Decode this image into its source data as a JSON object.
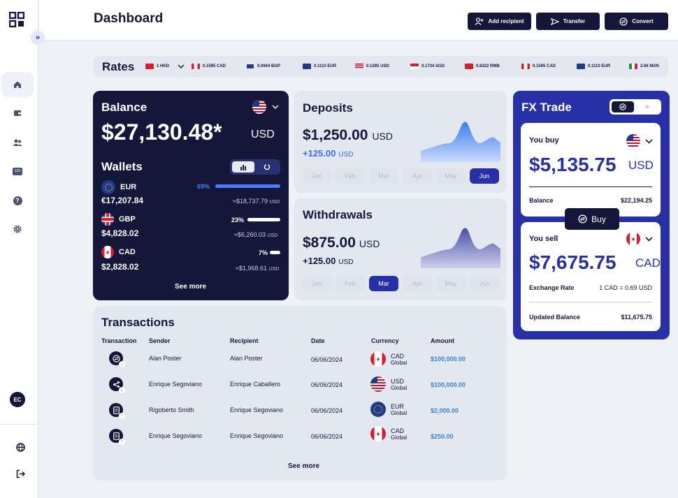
{
  "header": {
    "title": "Dashboard",
    "buttons": [
      {
        "label": "Add recipient",
        "icon": "add-user-icon"
      },
      {
        "label": "Transfer",
        "icon": "send-icon"
      },
      {
        "label": "Convert",
        "icon": "convert-icon"
      }
    ]
  },
  "sidebar": {
    "logo": "grid-logo",
    "items": [
      {
        "icon": "home-icon",
        "active": true
      },
      {
        "icon": "wallet-icon"
      },
      {
        "icon": "users-icon"
      },
      {
        "icon": "number-icon"
      },
      {
        "icon": "help-icon"
      },
      {
        "icon": "settings-icon"
      }
    ],
    "number_icon_text": "123",
    "avatar_initials": "EC",
    "bottom": [
      {
        "icon": "globe-icon"
      },
      {
        "icon": "logout-icon"
      }
    ]
  },
  "rates": {
    "title": "Rates",
    "items": [
      {
        "label": "1 HKD",
        "flag_color": "#d81e2c"
      },
      {
        "label": "0.1595 CAD",
        "flag_color": "#d81e2c"
      },
      {
        "label": "0.0944 BGP",
        "flag_color": "#1f3b8a"
      },
      {
        "label": "0.1110 EUR",
        "flag_color": "#1f3b8a"
      },
      {
        "label": "0.1285 USD",
        "flag_color": "#1f3b8a"
      },
      {
        "label": "0.1734 SGD",
        "flag_color": "#d81e2c"
      },
      {
        "label": "0.8222 RMB",
        "flag_color": "#d81e2c"
      },
      {
        "label": "0.1595 CAD",
        "flag_color": "#d81e2c"
      },
      {
        "label": "0.1110 EUR",
        "flag_color": "#1f3b8a"
      },
      {
        "label": "2.66 MXN",
        "flag_color": "#2d8a3e"
      }
    ]
  },
  "balance": {
    "title": "Balance",
    "amount": "$27,130.48*",
    "currency": "USD",
    "wallets_title": "Wallets",
    "see_more": "See more",
    "wallets": [
      {
        "code": "EUR",
        "amount": "€17,207.84",
        "percent": "69%",
        "percent_value": 0.69,
        "approx": "≈$18,737.79",
        "approx_unit": "USD",
        "accent": true
      },
      {
        "code": "GBP",
        "amount": "$4,828.02",
        "percent": "23%",
        "percent_value": 0.23,
        "approx": "≈$6,260.03",
        "approx_unit": "USD",
        "accent": false
      },
      {
        "code": "CAD",
        "amount": "$2,828.02",
        "percent": "7%",
        "percent_value": 0.07,
        "approx": "≈$1,968.61",
        "approx_unit": "USD",
        "accent": false
      }
    ]
  },
  "deposits": {
    "title": "Deposits",
    "amount": "$1,250.00",
    "currency": "USD",
    "change": "+125.00",
    "change_unit": "USD",
    "months": [
      "Jan",
      "Feb",
      "Mar",
      "Apr",
      "May",
      "Jun"
    ],
    "active_month": 5
  },
  "withdrawals": {
    "title": "Withdrawals",
    "amount": "$875.00",
    "currency": "USD",
    "change": "+125.00",
    "change_unit": "USD",
    "months": [
      "Jan",
      "Feb",
      "Mar",
      "Apr",
      "May",
      "Jun"
    ],
    "active_month": 2
  },
  "fx": {
    "title": "FX Trade",
    "buy": {
      "label": "You buy",
      "amount": "$5,135.75",
      "currency": "USD",
      "balance_label": "Balance",
      "balance_value": "$22,194.25"
    },
    "buy_button": "Buy",
    "sell": {
      "label": "You sell",
      "amount": "$7,675.75",
      "currency": "CAD",
      "rate_label": "Exchange Rate",
      "rate_value": "1 CAD = 0.69 USD",
      "updated_label": "Updated Balance",
      "updated_value": "$11,675.75"
    }
  },
  "transactions": {
    "title": "Transactions",
    "headers": [
      "Transaction",
      "Sender",
      "Recipient",
      "Date",
      "Currency",
      "Amount"
    ],
    "see_more": "See more",
    "rows": [
      {
        "icon": "convert-icon",
        "sender": "Alan Poster",
        "recipient": "Alan Poster",
        "date": "06/06/2024",
        "currency": "CAD",
        "currency_sub": "Global",
        "flag": "ca",
        "amount": "$100,000.00"
      },
      {
        "icon": "share-icon",
        "sender": "Enrique Segoviano",
        "recipient": "Enrique Caballero",
        "date": "06/06/2024",
        "currency": "USD",
        "currency_sub": "Global",
        "flag": "us",
        "amount": "$100,000.00"
      },
      {
        "icon": "document-icon",
        "sender": "Rigoberto Smith",
        "recipient": "Enrique Segoviano",
        "date": "06/06/2024",
        "currency": "EUR",
        "currency_sub": "Global",
        "flag": "eu",
        "amount": "$2,000.00"
      },
      {
        "icon": "document-icon",
        "sender": "Enrique Segoviano",
        "recipient": "Enrique Segoviano",
        "date": "06/06/2024",
        "currency": "CAD",
        "currency_sub": "Global",
        "flag": "ca",
        "amount": "$250.00"
      }
    ]
  },
  "colors": {
    "navy": "#14173a",
    "accent": "#2830a8",
    "link": "#3b82d6"
  }
}
